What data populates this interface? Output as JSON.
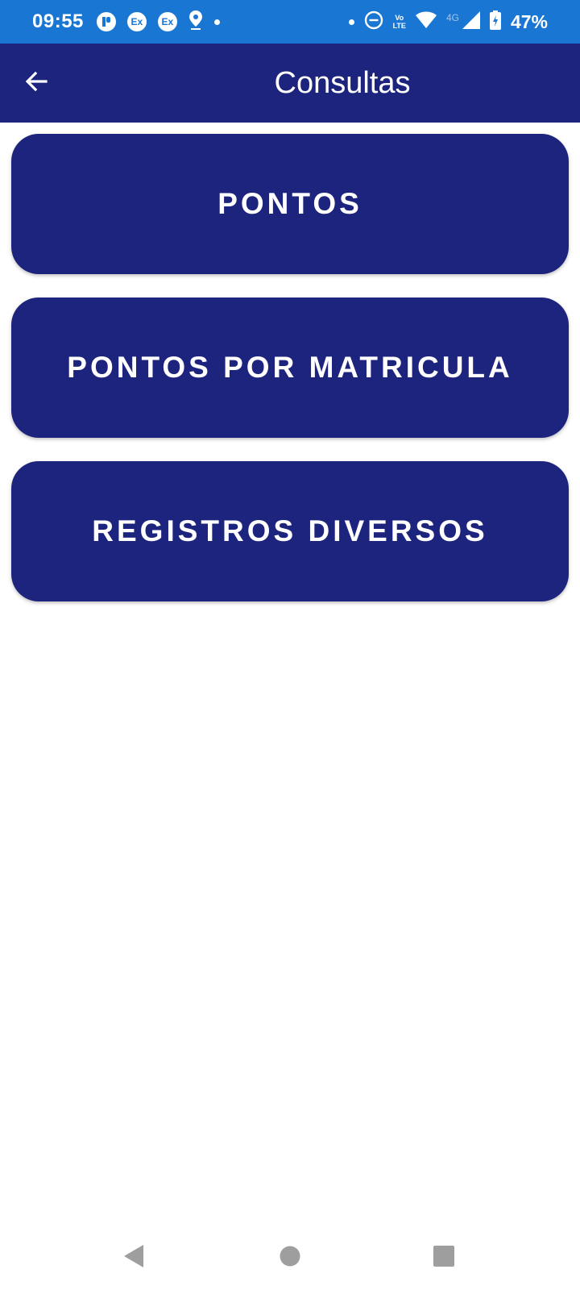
{
  "status_bar": {
    "time": "09:55",
    "notification_icons": [
      "app-icon",
      "ex-icon",
      "ex-icon",
      "location-icon"
    ],
    "ex_label": "Ex",
    "volte_line1": "Vo",
    "volte_line2": "LTE",
    "network": "4G",
    "battery_percent": "47%"
  },
  "app_bar": {
    "title": "Consultas"
  },
  "menu": {
    "items": [
      {
        "label": "PONTOS"
      },
      {
        "label": "PONTOS POR MATRICULA"
      },
      {
        "label": "REGISTROS DIVERSOS"
      }
    ]
  },
  "colors": {
    "status_bar": "#1976d2",
    "primary": "#1d247d",
    "background": "#ffffff",
    "nav_icons": "#9e9e9e"
  }
}
